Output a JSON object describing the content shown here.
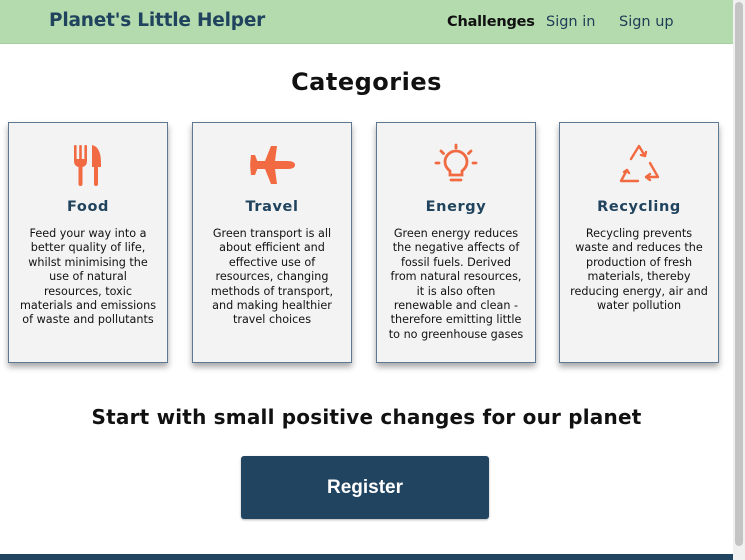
{
  "brand": "Planet's Little Helper",
  "nav": [
    {
      "label": "Challenges"
    },
    {
      "label": "Sign in"
    },
    {
      "label": "Sign up"
    }
  ],
  "categories_title": "Categories",
  "accent_color": "#f26a42",
  "primary_color": "#214461",
  "cards": [
    {
      "icon": "fork-knife-icon",
      "title": "Food",
      "description": "Feed your way into a better quality of life, whilst minimising the use of natural resources, toxic materials and emissions of waste and pollutants"
    },
    {
      "icon": "airplane-icon",
      "title": "Travel",
      "description": "Green transport is all about efficient and effective use of resources, changing methods of transport, and making healthier travel choices"
    },
    {
      "icon": "lightbulb-icon",
      "title": "Energy",
      "description": "Green energy reduces the negative affects of fossil fuels. Derived from natural resources, it is also often renewable and clean - therefore emitting little to no greenhouse gases"
    },
    {
      "icon": "recycle-icon",
      "title": "Recycling",
      "description": "Recycling prevents waste and reduces the production of fresh materials, thereby reducing energy, air and water pollution"
    }
  ],
  "tagline": "Start with small positive changes for our planet",
  "register_label": "Register"
}
